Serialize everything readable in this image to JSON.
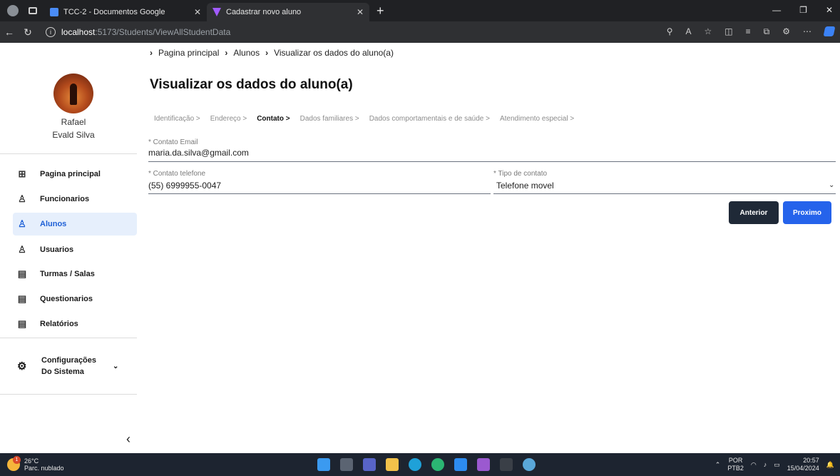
{
  "browser": {
    "tabs": [
      {
        "title": "TCC-2 - Documentos Google",
        "active": false
      },
      {
        "title": "Cadastrar novo aluno",
        "active": true
      }
    ],
    "new_tab": "+",
    "url_host": "localhost",
    "url_path": ":5173/Students/ViewAllStudentData"
  },
  "user": {
    "first_name": "Rafael",
    "last_name": "Evald Silva"
  },
  "sidebar": {
    "items": [
      {
        "label": "Pagina principal",
        "icon": "grid-icon"
      },
      {
        "label": "Funcionarios",
        "icon": "user-icon"
      },
      {
        "label": "Alunos",
        "icon": "user-icon",
        "active": true
      },
      {
        "label": "Usuarios",
        "icon": "user-icon"
      },
      {
        "label": "Turmas / Salas",
        "icon": "document-icon"
      },
      {
        "label": "Questionarios",
        "icon": "document-icon"
      },
      {
        "label": "Relatórios",
        "icon": "document-icon"
      }
    ],
    "settings_label": "Configurações Do Sistema",
    "collapse_label": "‹"
  },
  "breadcrumb": [
    "Pagina principal",
    "Alunos",
    "Visualizar os dados do aluno(a)"
  ],
  "page_title": "Visualizar os dados do aluno(a)",
  "steps": [
    {
      "label": "Identificação >",
      "current": false
    },
    {
      "label": "Endereço >",
      "current": false
    },
    {
      "label": "Contato >",
      "current": true
    },
    {
      "label": "Dados familiares >",
      "current": false
    },
    {
      "label": "Dados comportamentais e de saúde >",
      "current": false
    },
    {
      "label": "Atendimento especial >",
      "current": false
    }
  ],
  "form": {
    "email_label": "* Contato Email",
    "email_value": "maria.da.silva@gmail.com",
    "phone_label": "* Contato telefone",
    "phone_value": "(55) 6999955-0047",
    "contact_type_label": "* Tipo de contato",
    "contact_type_value": "Telefone movel"
  },
  "buttons": {
    "previous": "Anterior",
    "next": "Proximo"
  },
  "taskbar": {
    "temperature": "26°C",
    "weather": "Parc. nublado",
    "weather_badge": "1",
    "language_top": "POR",
    "language_bottom": "PTB2",
    "time": "20:57",
    "date": "15/04/2024"
  },
  "colors": {
    "accent": "#2563eb",
    "dark_button": "#1f2937",
    "active_bg": "#e6effc"
  }
}
